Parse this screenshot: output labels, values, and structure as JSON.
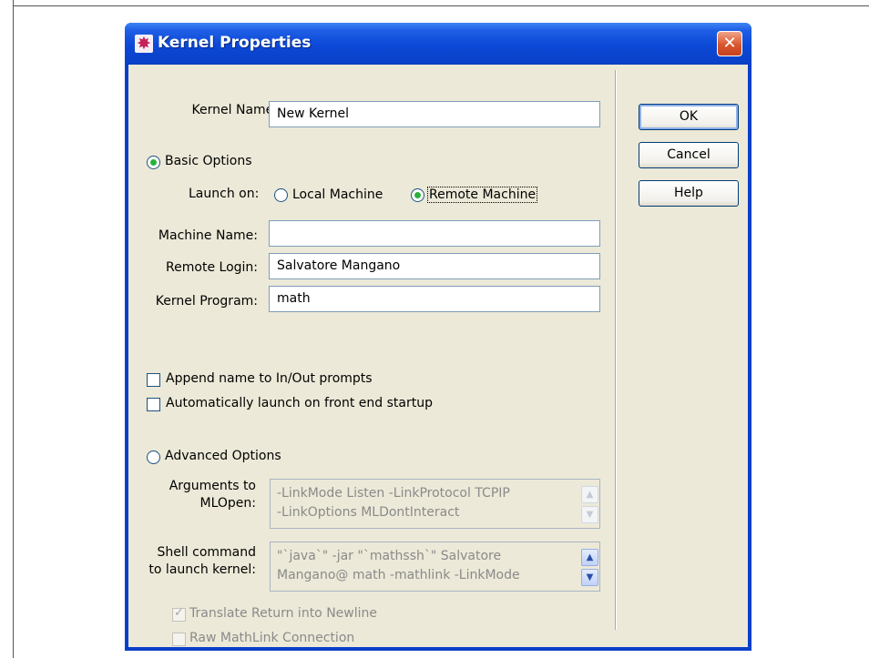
{
  "dialog": {
    "title": "Kernel Properties",
    "close_glyph": "✕",
    "icon": "kernel-app-icon"
  },
  "kernel_name": {
    "label": "Kernel Name:",
    "value": "New Kernel"
  },
  "basic_options": {
    "label": "Basic Options",
    "selected": true
  },
  "launch_on": {
    "label": "Launch on:",
    "local_machine": "Local Machine",
    "remote_machine": "Remote Machine",
    "selected": "Remote Machine"
  },
  "machine_name": {
    "label": "Machine Name:",
    "value": ""
  },
  "remote_login": {
    "label": "Remote Login:",
    "value": "Salvatore Mangano"
  },
  "kernel_program": {
    "label": "Kernel Program:",
    "value": "math"
  },
  "checkboxes": {
    "append_name": {
      "label": "Append name to In/Out prompts",
      "checked": false
    },
    "auto_launch": {
      "label": "Automatically launch on front end startup",
      "checked": false
    }
  },
  "advanced_options": {
    "label": "Advanced Options",
    "selected": false
  },
  "arguments": {
    "label_line1": "Arguments to",
    "label_line2": "MLOpen:",
    "line1": "-LinkMode Listen -LinkProtocol TCPIP",
    "line2": "-LinkOptions MLDontInteract"
  },
  "shell_command": {
    "label_line1": "Shell command",
    "label_line2": "to launch kernel:",
    "line1": "\"`java`\" -jar \"`mathssh`\" Salvatore",
    "line2": "Mangano@ math -mathlink -LinkMode"
  },
  "translate_return": {
    "label": "Translate Return into Newline",
    "checked": true
  },
  "raw_mathlink": {
    "label": "Raw MathLink Connection",
    "checked": false
  },
  "buttons": {
    "ok": "OK",
    "cancel": "Cancel",
    "help": "Help"
  },
  "colors": {
    "titlebar": "#0b48d6",
    "client_bg": "#ece9d8",
    "radio_dot": "#2bb03b",
    "close_button": "#d9562e"
  }
}
